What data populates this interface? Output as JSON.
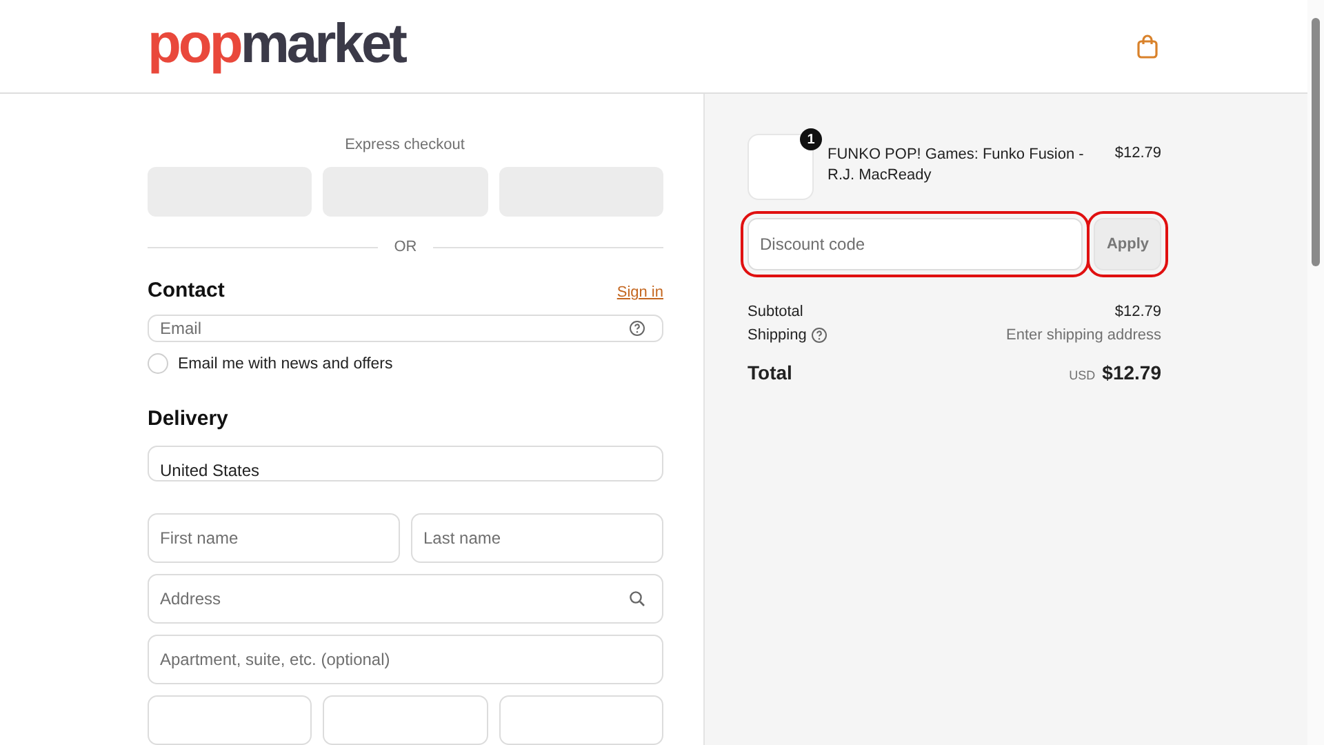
{
  "header": {
    "logo": {
      "part_1": "pop",
      "part_2": "market"
    }
  },
  "checkout": {
    "express_label": "Express checkout",
    "express_buttons": [
      {
        "kind": "blank"
      },
      {
        "kind": "blank"
      },
      {
        "kind": "blank"
      }
    ],
    "divider_label": "OR",
    "contact": {
      "heading": "Contact",
      "sign_in_link": "Sign in",
      "email": {
        "placeholder": "Email"
      },
      "newsletter": {
        "label": "Email me with news and offers",
        "checked": false
      }
    },
    "delivery": {
      "heading": "Delivery",
      "country": {
        "value": "United States"
      },
      "fields": [
        {
          "kind": "pair",
          "items": [
            {
              "placeholder": "First name"
            },
            {
              "placeholder": "Last name"
            }
          ]
        },
        {
          "kind": "search",
          "placeholder": "Address"
        },
        {
          "kind": "single",
          "placeholder": "Apartment, suite, etc. (optional)"
        },
        {
          "kind": "cut_off_triple"
        }
      ]
    }
  },
  "summary": {
    "product": {
      "quantity": "1",
      "name": "FUNKO POP! Games: Funko Fusion - R.J. MacReady",
      "price": "$12.79"
    },
    "discount": {
      "placeholder": "Discount code",
      "highlighted": true
    },
    "apply_button": {
      "label": "Apply",
      "highlighted": true
    },
    "subtotal": {
      "label": "Subtotal",
      "value": "$12.79"
    },
    "shipping": {
      "label": "Shipping",
      "value": "Enter shipping address"
    },
    "total": {
      "label": "Total",
      "currency": "USD",
      "value": "$12.79"
    }
  }
}
